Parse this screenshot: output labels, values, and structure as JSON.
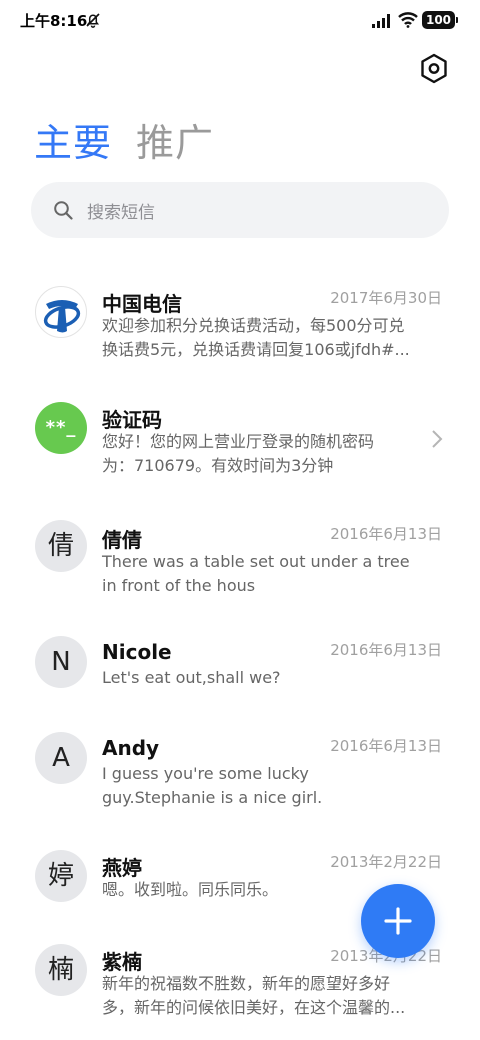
{
  "status_bar": {
    "time": "上午8:16",
    "battery": "100"
  },
  "icons": {
    "mute": "bell-off-icon",
    "signal": "signal-icon",
    "wifi": "wifi-icon",
    "settings": "hexagon-settings-icon",
    "search": "search-icon",
    "chevron": "chevron-right-icon",
    "compose": "plus-icon"
  },
  "colors": {
    "accent": "#3478f6",
    "fab": "#2f7bf5",
    "code_avatar": "#67c94f"
  },
  "tabs": [
    {
      "label": "主要",
      "active": true
    },
    {
      "label": "推广",
      "active": false
    }
  ],
  "search": {
    "placeholder": "搜索短信"
  },
  "messages": [
    {
      "name": "中国电信",
      "date": "2017年6月30日",
      "avatar": "",
      "snippet_1": "欢迎参加积分兑换话费活动，每500分可兑",
      "snippet_2": "换话费5元，兑换话费请回复106或jfdh#..."
    },
    {
      "name": "验证码",
      "date": "",
      "avatar": "**_",
      "snippet_1": "您好！您的网上营业厅登录的随机密码",
      "snippet_2": "为：710679。有效时间为3分钟"
    },
    {
      "name": "倩倩",
      "date": "2016年6月13日",
      "avatar": "倩",
      "snippet_1": "There was a table set out under a tree",
      "snippet_2": "in front of the hous"
    },
    {
      "name": "Nicole",
      "date": "2016年6月13日",
      "avatar": "N",
      "snippet_1": "Let's eat out,shall we?",
      "snippet_2": ""
    },
    {
      "name": "Andy",
      "date": "2016年6月13日",
      "avatar": "A",
      "snippet_1": "I guess you're some lucky",
      "snippet_2": "guy.Stephanie is a nice girl."
    },
    {
      "name": "燕婷",
      "date": "2013年2月22日",
      "avatar": "婷",
      "snippet_1": "嗯。收到啦。同乐同乐。",
      "snippet_2": ""
    },
    {
      "name": "紫楠",
      "date": "2013年2月22日",
      "avatar": "楠",
      "snippet_1": "新年的祝福数不胜数，新年的愿望好多好",
      "snippet_2": "多，新年的问候依旧美好，在这个温馨的..."
    }
  ]
}
